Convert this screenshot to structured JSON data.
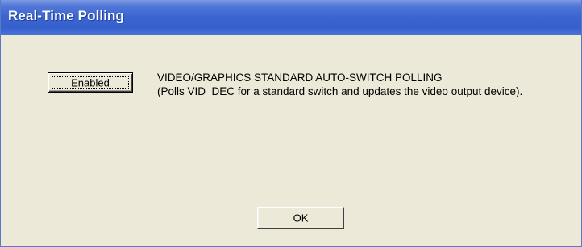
{
  "window": {
    "title": "Real-Time Polling",
    "title_bar_color": "#3a63cf",
    "background_color": "#ece9d8"
  },
  "polling": {
    "toggle_label": "Enabled",
    "heading": "VIDEO/GRAPHICS STANDARD AUTO-SWITCH POLLING",
    "description": "(Polls VID_DEC for a standard switch and updates the video output device)."
  },
  "footer": {
    "ok_label": "OK"
  }
}
